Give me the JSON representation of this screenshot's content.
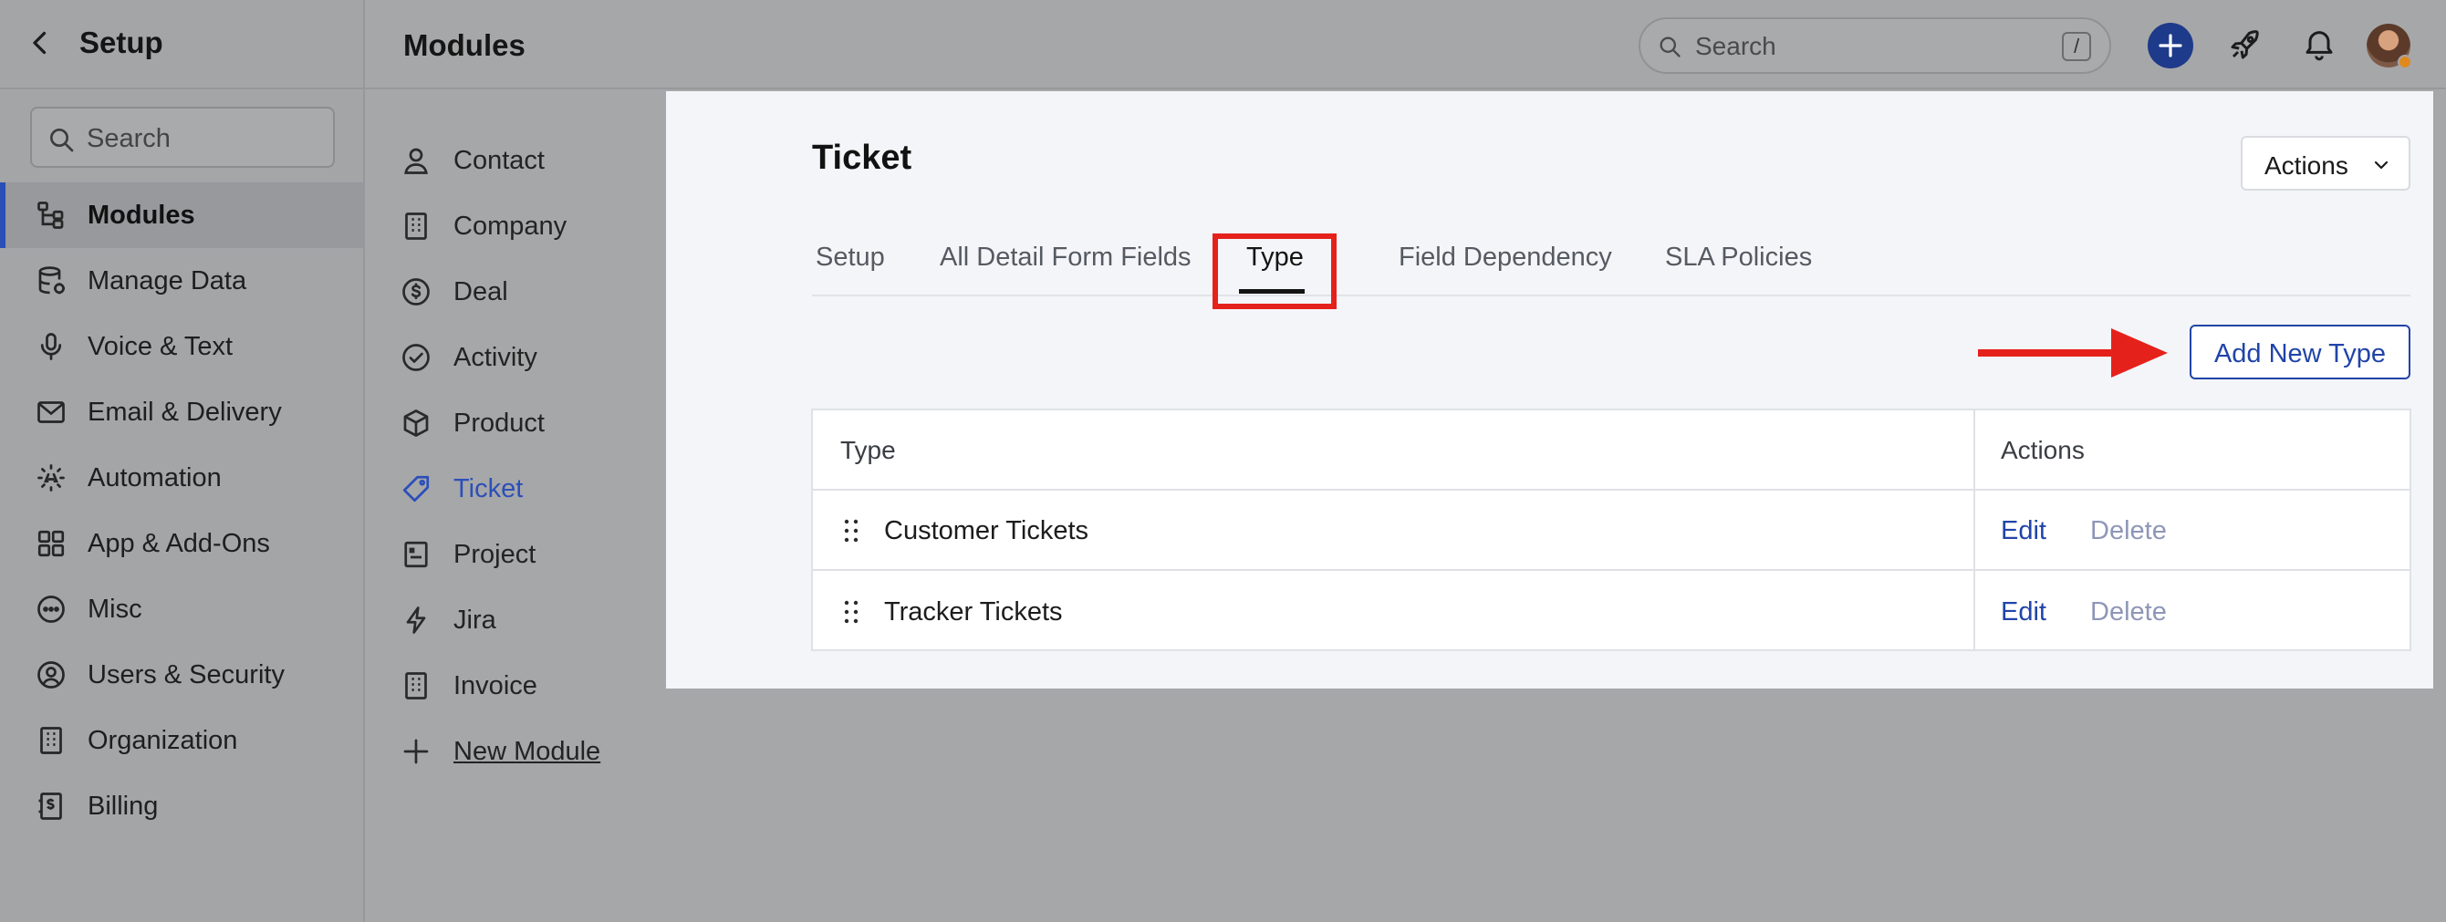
{
  "sidebar": {
    "title": "Setup",
    "search_placeholder": "Search",
    "items": [
      {
        "label": "Modules",
        "icon": "hierarchy-icon",
        "active": true
      },
      {
        "label": "Manage Data",
        "icon": "database-icon"
      },
      {
        "label": "Voice & Text",
        "icon": "microphone-icon"
      },
      {
        "label": "Email & Delivery",
        "icon": "envelope-icon"
      },
      {
        "label": "Automation",
        "icon": "automation-icon"
      },
      {
        "label": "App & Add-Ons",
        "icon": "grid-icon"
      },
      {
        "label": "Misc",
        "icon": "ellipsis-circle-icon"
      },
      {
        "label": "Users & Security",
        "icon": "user-circle-icon"
      },
      {
        "label": "Organization",
        "icon": "building-icon"
      },
      {
        "label": "Billing",
        "icon": "receipt-icon"
      }
    ]
  },
  "topbar": {
    "title": "Modules",
    "search_placeholder": "Search",
    "search_shortcut": "/"
  },
  "modules": {
    "items": [
      {
        "label": "Contact",
        "icon": "person-icon"
      },
      {
        "label": "Company",
        "icon": "building-icon"
      },
      {
        "label": "Deal",
        "icon": "dollar-circle-icon"
      },
      {
        "label": "Activity",
        "icon": "check-circle-icon"
      },
      {
        "label": "Product",
        "icon": "box-icon"
      },
      {
        "label": "Ticket",
        "icon": "tag-icon",
        "active": true
      },
      {
        "label": "Project",
        "icon": "project-icon"
      },
      {
        "label": "Jira",
        "icon": "lightning-icon"
      },
      {
        "label": "Invoice",
        "icon": "building-icon"
      }
    ],
    "new_module_label": "New Module"
  },
  "panel": {
    "title": "Ticket",
    "actions_label": "Actions",
    "tabs": [
      "Setup",
      "All Detail Form Fields",
      "Type",
      "Field Dependency",
      "SLA Policies"
    ],
    "active_tab": "Type",
    "add_button_label": "Add New Type",
    "table": {
      "headers": [
        "Type",
        "Actions"
      ],
      "rows": [
        {
          "type": "Customer Tickets",
          "edit": "Edit",
          "delete": "Delete"
        },
        {
          "type": "Tracker Tickets",
          "edit": "Edit",
          "delete": "Delete"
        }
      ]
    }
  },
  "colors": {
    "accent": "#2144a8",
    "active_nav": "#2c4fb8",
    "highlight": "#e5211c",
    "overlay": "#a6a7a9",
    "panel_bg": "#f4f5f8"
  }
}
